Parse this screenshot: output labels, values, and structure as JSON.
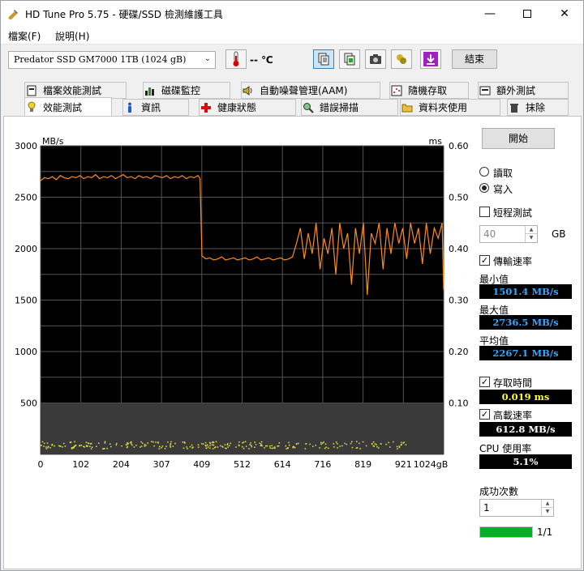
{
  "window": {
    "title": "HD Tune Pro 5.75 - 硬碟/SSD 檢測維護工具"
  },
  "menu": {
    "file": "檔案(F)",
    "help": "說明(H)"
  },
  "toolbar": {
    "drive": "Predator SSD GM7000 1TB (1024 gB)",
    "temperature": "-- ℃",
    "exit": "結束"
  },
  "tabs": {
    "row1": [
      "檔案效能測試",
      "磁碟監控",
      "自動噪聲管理(AAM)",
      "隨機存取",
      "額外測試"
    ],
    "row2": [
      "效能測試",
      "資訊",
      "健康狀態",
      "錯誤掃描",
      "資料夾使用",
      "抹除"
    ]
  },
  "controls": {
    "start": "開始",
    "read": "讀取",
    "write": "寫入",
    "short_test": "短程測試",
    "short_value": "40",
    "gb": "GB",
    "transfer_rate": "傳輸速率",
    "min_label": "最小值",
    "min_value": "1501.4 MB/s",
    "max_label": "最大值",
    "max_value": "2736.5 MB/s",
    "avg_label": "平均值",
    "avg_value": "2267.1 MB/s",
    "access_time": "存取時間",
    "access_value": "0.019 ms",
    "burst_rate": "高載速率",
    "burst_value": "612.8 MB/s",
    "cpu_label": "CPU 使用率",
    "cpu_value": "5.1%",
    "success_label": "成功次數",
    "success_value": "1",
    "progress_text": "1/1",
    "progress": 1.0
  },
  "chart_data": {
    "type": "line",
    "ylabel_left": "MB/s",
    "ylabel_right": "ms",
    "xlabel": "gB",
    "x_ticks": [
      "0",
      "102",
      "204",
      "307",
      "409",
      "512",
      "614",
      "716",
      "819",
      "921",
      "1024gB"
    ],
    "y_left_ticks": [
      "3000",
      "2500",
      "2000",
      "1500",
      "1000",
      "500"
    ],
    "y_right_ticks": [
      "0.60",
      "0.50",
      "0.40",
      "0.30",
      "0.20",
      "0.10"
    ],
    "ylim": [
      0,
      3000
    ],
    "xlim": [
      0,
      1024
    ],
    "series": [
      {
        "color": "#ff8c1a",
        "x": [
          0,
          10,
          20,
          30,
          40,
          50,
          60,
          70,
          80,
          90,
          100,
          110,
          120,
          130,
          140,
          150,
          160,
          170,
          180,
          190,
          200,
          210,
          220,
          230,
          240,
          250,
          260,
          270,
          280,
          290,
          300,
          310,
          320,
          330,
          340,
          350,
          360,
          370,
          380,
          390,
          400,
          405,
          410,
          420,
          430,
          440,
          450,
          460,
          470,
          480,
          490,
          500,
          510,
          520,
          530,
          540,
          550,
          560,
          570,
          580,
          590,
          600,
          610,
          620,
          630,
          640,
          650,
          660,
          670,
          680,
          690,
          700,
          710,
          720,
          730,
          740,
          750,
          760,
          770,
          780,
          790,
          800,
          810,
          820,
          830,
          840,
          850,
          860,
          870,
          880,
          890,
          900,
          910,
          920,
          930,
          940,
          950,
          960,
          970,
          980,
          990,
          1000,
          1010,
          1020,
          1024
        ],
        "values": [
          2660,
          2690,
          2680,
          2700,
          2670,
          2710,
          2690,
          2680,
          2700,
          2690,
          2710,
          2680,
          2700,
          2690,
          2720,
          2680,
          2700,
          2690,
          2710,
          2680,
          2700,
          2720,
          2690,
          2700,
          2680,
          2710,
          2690,
          2700,
          2680,
          2710,
          2700,
          2690,
          2710,
          2680,
          2700,
          2690,
          2710,
          2680,
          2700,
          2690,
          2710,
          2680,
          1930,
          1900,
          1910,
          1890,
          1900,
          1920,
          1890,
          1900,
          1910,
          1890,
          1900,
          1910,
          1890,
          1900,
          1920,
          1890,
          1900,
          1910,
          1890,
          1900,
          1910,
          1890,
          1900,
          1920,
          2050,
          2200,
          1900,
          2150,
          1950,
          2250,
          1800,
          2100,
          1950,
          2200,
          1750,
          2250,
          2000,
          2150,
          1650,
          2200,
          1950,
          2250,
          1550,
          2150,
          2050,
          2250,
          1800,
          2200,
          1950,
          2250,
          2050,
          2200,
          1900,
          2250,
          2050,
          2200,
          1850,
          2250,
          1950,
          2200,
          2100,
          2250,
          1600
        ],
        "axis": "left"
      },
      {
        "color": "#e8e83a",
        "axis": "right",
        "scatter_y_range": [
          0.012,
          0.026
        ]
      }
    ],
    "grid": true
  }
}
